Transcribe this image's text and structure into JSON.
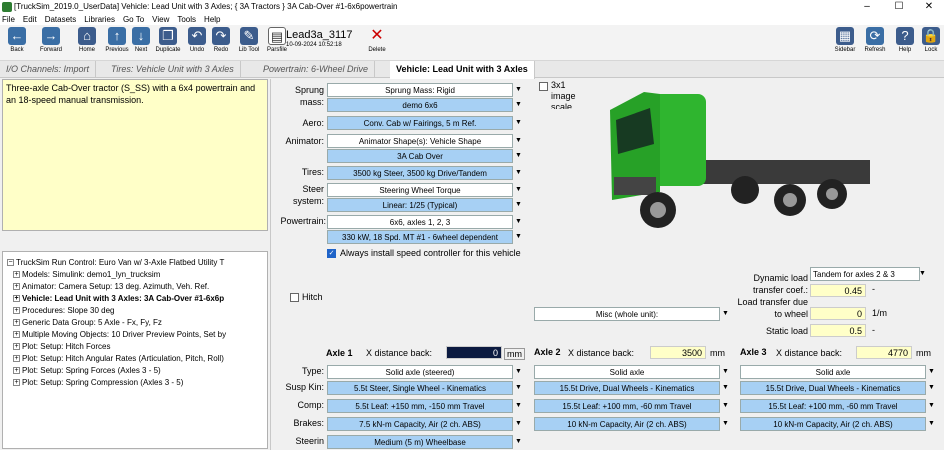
{
  "window": {
    "title": "[TruckSim_2019.0_UserData] Vehicle: Lead Unit with 3 Axles; { 3A Tractors } 3A Cab-Over #1-6x6powertrain",
    "min": "–",
    "max": "☐",
    "close": "✕"
  },
  "menu": [
    "File",
    "Edit",
    "Datasets",
    "Libraries",
    "Go To",
    "View",
    "Tools",
    "Help"
  ],
  "toolbar": {
    "back": "Back",
    "forward": "Forward",
    "home": "Home",
    "previous": "Previous",
    "next": "Next",
    "duplicate": "Duplicate",
    "undo": "Undo",
    "redo": "Redo",
    "libtool": "Lib Tool",
    "parsfile": "Parsfile",
    "delete": "Delete",
    "sidebar": "Sidebar",
    "refresh": "Refresh",
    "help": "Help",
    "lock": "Lock"
  },
  "parsfile": {
    "name": "Lead3a_3117",
    "date": "10-09-2024 10:52:18"
  },
  "tabs": [
    "I/O Channels: Import",
    "Tires: Vehicle Unit with 3 Axles",
    "Powertrain: 6-Wheel Drive",
    "Vehicle: Lead Unit with 3 Axles"
  ],
  "notes": "Three-axle Cab-Over tractor (S_SS) with a 6x4 powertrain and an 18-speed manual transmission.",
  "tree": {
    "root": "TruckSim Run Control: Euro Van w/ 3-Axle Flatbed Utility T",
    "items": [
      "Models: Simulink: demo1_lyn_trucksim",
      "Animator: Camera Setup: 13 deg. Azimuth, Veh. Ref.",
      "Vehicle: Lead Unit with 3 Axles: 3A Cab-Over #1-6x6p",
      "Procedures: Slope 30 deg",
      "Generic Data Group: 5 Axle - Fx, Fy, Fz",
      "Multiple Moving Objects: 10 Driver Preview Points, Set by",
      "Plot: Setup: Hitch Forces",
      "Plot: Setup: Hitch Angular Rates (Articulation, Pitch, Roll)",
      "Plot: Setup: Spring Forces (Axles 3 - 5)",
      "Plot: Setup: Spring Compression (Axles 3 - 5)"
    ]
  },
  "form": {
    "sprung_label": "Sprung mass:",
    "sprung_cat": "Sprung Mass: Rigid",
    "sprung_val": "demo 6x6",
    "aero_label": "Aero:",
    "aero_val": "Conv. Cab w/ Fairings, 5 m Ref.",
    "animator_label": "Animator:",
    "animator_cat": "Animator Shape(s): Vehicle Shape",
    "animator_val": "3A Cab Over",
    "tires_label": "Tires:",
    "tires_val": "3500 kg Steer, 3500 kg Drive/Tandem",
    "steer_label": "Steer system:",
    "steer_cat": "Steering Wheel Torque",
    "steer_val": "Linear: 1/25 (Typical)",
    "powertrain_label": "Powertrain:",
    "powertrain_cat": "6x6, axles 1, 2, 3",
    "powertrain_val": "330 kW, 18 Spd. MT #1 - 6wheel dependent",
    "speed_ctrl": "Always install speed controller for this vehicle",
    "scale_cb": "3x1 image scale",
    "hitch": "Hitch",
    "misc": "Misc (whole unit):",
    "dyn_load_label": "Dynamic load transfer coef.:",
    "dyn_load_dd": "Tandem for axles 2 & 3",
    "dyn_load_val": "0.45",
    "dyn_load_unit": "-",
    "lt_label": "Load transfer due to wheel",
    "lt_val": "0",
    "lt_unit": "1/m",
    "static_label": "Static load",
    "static_val": "0.5",
    "static_unit": "-"
  },
  "axles": [
    {
      "title": "Axle 1",
      "xlabel": "X distance back:",
      "x": "0",
      "unit": "mm",
      "type": "Solid axle (steered)",
      "kin": "5.5t Steer, Single Wheel - Kinematics",
      "comp": "5.5t Leaf: +150 mm, -150 mm Travel",
      "brakes": "7.5 kN-m Capacity, Air (2 ch. ABS)",
      "steering": "Medium (5 m) Wheelbase"
    },
    {
      "title": "Axle 2",
      "xlabel": "X distance back:",
      "x": "3500",
      "unit": "mm",
      "type": "Solid axle",
      "kin": "15.5t Drive, Dual Wheels - Kinematics",
      "comp": "15.5t Leaf: +100 mm, -60 mm Travel",
      "brakes": "10 kN-m Capacity, Air (2 ch. ABS)"
    },
    {
      "title": "Axle 3",
      "xlabel": "X distance back:",
      "x": "4770",
      "unit": "mm",
      "type": "Solid axle",
      "kin": "15.5t Drive, Dual Wheels - Kinematics",
      "comp": "15.5t Leaf: +100 mm, -60 mm Travel",
      "brakes": "10 kN-m Capacity, Air (2 ch. ABS)"
    }
  ],
  "row_labels": {
    "type": "Type:",
    "kin": "Susp Kin:",
    "comp": "Comp:",
    "brakes": "Brakes:",
    "steering": "Steerin"
  },
  "colors": {
    "accent": "#a7d0f4",
    "truck": "#2fb52f",
    "field": "#ffffc8"
  }
}
